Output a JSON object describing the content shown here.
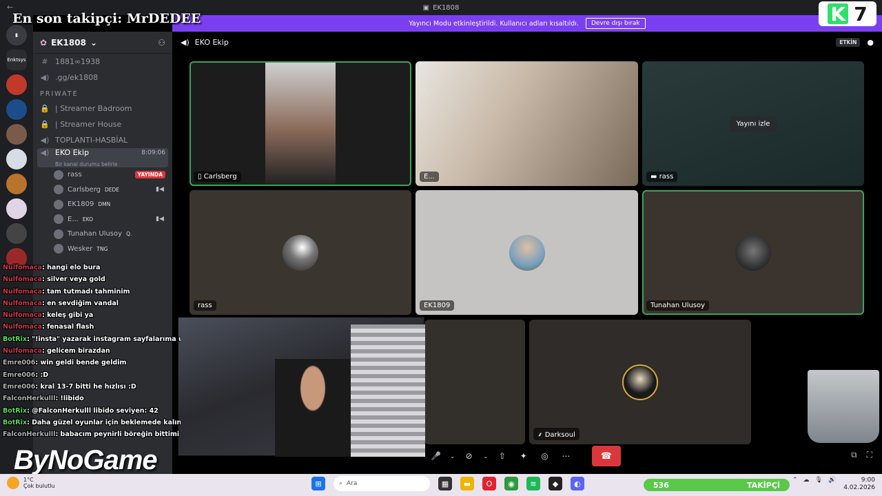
{
  "window": {
    "title": "EK1808",
    "back": "←",
    "min": "—",
    "max": "☐"
  },
  "banner": {
    "text": "Yayıncı Modu etkinleştirildi. Kullanıcı adları kısaltıldı.",
    "button": "Devre dışı bırak",
    "close": "✕"
  },
  "overlay": {
    "follower_title": "En son takipçi: MrDEDEE",
    "k": "K",
    "seven": "7",
    "watermark": "ByNoGame"
  },
  "rail": {
    "items": [
      "Enktsys"
    ]
  },
  "server": {
    "name": "EK1808",
    "chevron": "⌄"
  },
  "channels": {
    "top": [
      {
        "icon": "#",
        "label": "1881∞1938"
      },
      {
        "icon": "◀)",
        "label": ".gg/ek1808"
      }
    ],
    "category": "PRIWATE",
    "private": [
      {
        "icon": "🔒",
        "label": "| Streamer Badroom"
      },
      {
        "icon": "🔒",
        "label": "| Streamer House"
      },
      {
        "icon": "◀)",
        "label": "TOPLANTI-HASBİAL"
      }
    ],
    "active": {
      "label": "EKO Ekip",
      "time": "8:09:06",
      "status": "Bir kanal durumu belirle"
    },
    "users": [
      {
        "name": "rass",
        "badge": "",
        "live": "YAYINDA",
        "cam": ""
      },
      {
        "name": "Carlsberg",
        "badge": "DEDE",
        "live": "",
        "cam": "▮◀"
      },
      {
        "name": "EK1809",
        "badge": "DMN",
        "live": "",
        "cam": ""
      },
      {
        "name": "E...",
        "badge": "EKO",
        "live": "",
        "cam": "▮◀"
      },
      {
        "name": "Tunahan Ulusoy",
        "badge": "Q.",
        "live": "",
        "cam": ""
      },
      {
        "name": "Wesker",
        "badge": "TNG",
        "live": "",
        "cam": ""
      }
    ]
  },
  "chat": [
    {
      "user": "Nulfomaca",
      "text": ": hangi elo bura",
      "cls": "red"
    },
    {
      "user": "Nulfomaca",
      "text": ": silver veya gold",
      "cls": "red"
    },
    {
      "user": "Nulfomaca",
      "text": ": tam tutmadı tahminim",
      "cls": "red"
    },
    {
      "user": "Nulfomaca",
      "text": ": en sevdiğim vandal",
      "cls": "red"
    },
    {
      "user": "Nulfomaca",
      "text": ": keleş gibi ya",
      "cls": "red"
    },
    {
      "user": "Nulfomaca",
      "text": ": fenasal flash",
      "cls": "red"
    },
    {
      "user": "BotRix",
      "text": ": \"!insta\" yazarak instagram sayfalarıma ulaşabilirsin",
      "cls": "grn"
    },
    {
      "user": "Nulfomaca",
      "text": ": gelicem birazdan",
      "cls": "red"
    },
    {
      "user": "Emre006",
      "text": ": win geldi bende geldim",
      "cls": ""
    },
    {
      "user": "Emre006",
      "text": ": :D",
      "cls": ""
    },
    {
      "user": "Emre006",
      "text": ": kral 13-7 bitti he hızlısı :D",
      "cls": ""
    },
    {
      "user": "FalconHerkulll",
      "text": ": !libido",
      "cls": ""
    },
    {
      "user": "BotRix",
      "text": ": @FalconHerkulll libido seviyen: 42",
      "cls": "grn"
    },
    {
      "user": "BotRix",
      "text": ": Daha güzel oyunlar için beklemede kalınız.",
      "cls": "grn"
    },
    {
      "user": "FalconHerkulll",
      "text": ": babacım peynirli böreğin bittimi ?",
      "cls": ""
    }
  ],
  "stage": {
    "channel": "EKO Ekip",
    "activity": "ETKİN",
    "watch_label": "Yayını izle"
  },
  "tiles": [
    {
      "name": "Carlsberg",
      "icon": "▯"
    },
    {
      "name": "E...",
      "icon": ""
    },
    {
      "name": "rass",
      "icon": "▬"
    },
    {
      "name": "rass",
      "icon": ""
    },
    {
      "name": "EK1809",
      "icon": ""
    },
    {
      "name": "Tunahan Ulusoy",
      "icon": ""
    },
    {
      "name": "Darksoul",
      "icon": "⸙"
    }
  ],
  "controls": {
    "mic": "🎤",
    "caret": "⌄",
    "cam": "⊘",
    "share": "⇧",
    "activity": "✦",
    "soundboard": "◎",
    "more": "⋯",
    "hangup": "☎"
  },
  "taskbar": {
    "temp": "1°C",
    "weather": "Çok bulutlu",
    "search": "Ara",
    "followers_count": "536",
    "followers_label": "TAKİPÇİ",
    "time": "9:00",
    "date": "4.02.2026"
  }
}
